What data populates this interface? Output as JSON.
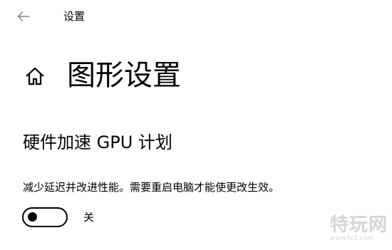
{
  "window": {
    "title": "设置"
  },
  "page": {
    "title": "图形设置"
  },
  "section": {
    "title": "硬件加速 GPU 计划",
    "description": "减少延迟并改进性能。需要重启电脑才能使更改生效。",
    "toggle": {
      "state": "off",
      "state_label": "关"
    }
  },
  "watermark": {
    "text": "特玩网",
    "subtext": "www.te5.com"
  },
  "icons": {
    "back": "back-arrow-icon",
    "home": "home-icon"
  },
  "colors": {
    "background": "#ffffff",
    "text": "#000000",
    "back_arrow": "#7a7a7a"
  }
}
